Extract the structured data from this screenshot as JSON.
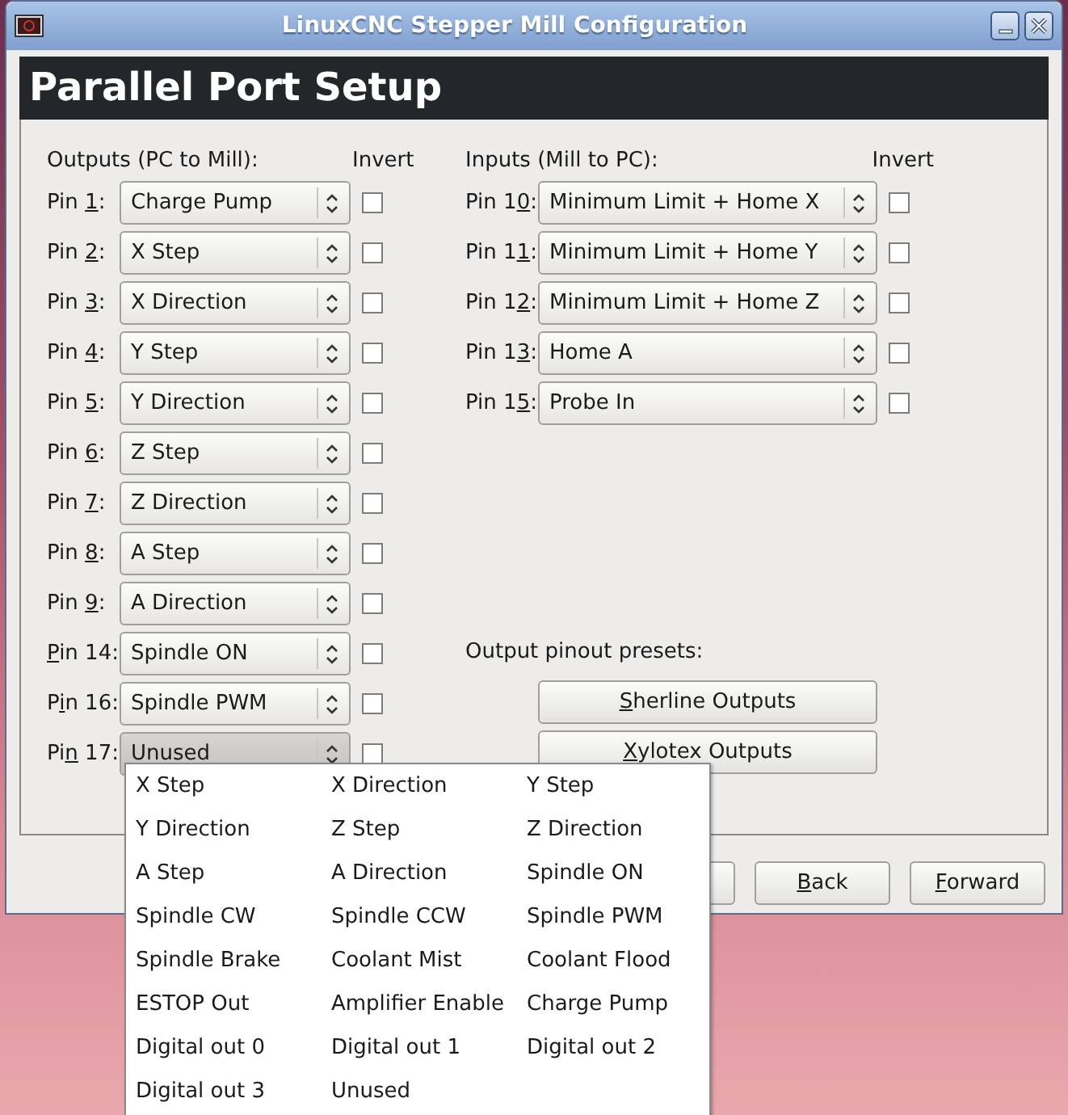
{
  "window": {
    "title": "LinuxCNC Stepper Mill Configuration"
  },
  "page_title": "Parallel Port Setup",
  "outputs": {
    "heading": "Outputs (PC to Mill):",
    "invert_heading": "Invert",
    "pins": [
      {
        "label": {
          "pre": "Pin ",
          "key": "1",
          "post": ":"
        },
        "value": "Charge Pump",
        "open": false,
        "checked": false
      },
      {
        "label": {
          "pre": "Pin ",
          "key": "2",
          "post": ":"
        },
        "value": "X Step",
        "open": false,
        "checked": false
      },
      {
        "label": {
          "pre": "Pin ",
          "key": "3",
          "post": ":"
        },
        "value": "X Direction",
        "open": false,
        "checked": false
      },
      {
        "label": {
          "pre": "Pin ",
          "key": "4",
          "post": ":"
        },
        "value": "Y Step",
        "open": false,
        "checked": false
      },
      {
        "label": {
          "pre": "Pin ",
          "key": "5",
          "post": ":"
        },
        "value": "Y Direction",
        "open": false,
        "checked": false
      },
      {
        "label": {
          "pre": "Pin ",
          "key": "6",
          "post": ":"
        },
        "value": "Z Step",
        "open": false,
        "checked": false
      },
      {
        "label": {
          "pre": "Pin ",
          "key": "7",
          "post": ":"
        },
        "value": "Z Direction",
        "open": false,
        "checked": false
      },
      {
        "label": {
          "pre": "Pin ",
          "key": "8",
          "post": ":"
        },
        "value": "A Step",
        "open": false,
        "checked": false
      },
      {
        "label": {
          "pre": "Pin ",
          "key": "9",
          "post": ":"
        },
        "value": "A Direction",
        "open": false,
        "checked": false
      },
      {
        "label": {
          "key": "P",
          "post": "in 14:"
        },
        "value": "Spindle ON",
        "open": false,
        "checked": false
      },
      {
        "label": {
          "pre": "P",
          "key": "i",
          "post": "n 16:"
        },
        "value": "Spindle PWM",
        "open": false,
        "checked": false
      },
      {
        "label": {
          "pre": "Pi",
          "key": "n",
          "post": " 17:"
        },
        "value": "Unused",
        "open": true,
        "checked": false
      }
    ]
  },
  "inputs": {
    "heading": "Inputs (Mill to PC):",
    "invert_heading": "Invert",
    "pins": [
      {
        "label": {
          "pre": "Pin 1",
          "key": "0",
          "post": ":"
        },
        "value": "Minimum Limit + Home X",
        "open": false,
        "checked": false
      },
      {
        "label": {
          "pre": "Pin 1",
          "key": "1",
          "post": ":"
        },
        "value": "Minimum Limit + Home Y",
        "open": false,
        "checked": false
      },
      {
        "label": {
          "pre": "Pin 1",
          "key": "2",
          "post": ":"
        },
        "value": "Minimum Limit + Home Z",
        "open": false,
        "checked": false
      },
      {
        "label": {
          "pre": "Pin 1",
          "key": "3",
          "post": ":"
        },
        "value": "Home A",
        "open": false,
        "checked": false
      },
      {
        "label": {
          "pre": "Pin 1",
          "key": "5",
          "post": ":"
        },
        "value": "Probe In",
        "open": false,
        "checked": false
      }
    ]
  },
  "presets": {
    "heading": "Output pinout presets:",
    "buttons": [
      {
        "key": "S",
        "post": "herline Outputs"
      },
      {
        "key": "X",
        "post": "ylotex Outputs"
      }
    ]
  },
  "buttons": [
    {
      "key": "B",
      "post": "ack"
    },
    {
      "key": "F",
      "post": "orward"
    }
  ],
  "dropdown_menu": {
    "items": [
      "X Step",
      "X Direction",
      "Y Step",
      "Y Direction",
      "Z Step",
      "Z Direction",
      "A Step",
      "A Direction",
      "Spindle ON",
      "Spindle CW",
      "Spindle CCW",
      "Spindle PWM",
      "Spindle Brake",
      "Coolant Mist",
      "Coolant Flood",
      "ESTOP Out",
      "Amplifier Enable",
      "Charge Pump",
      "Digital out 0",
      "Digital out 1",
      "Digital out 2",
      "Digital out 3",
      "Unused"
    ]
  }
}
